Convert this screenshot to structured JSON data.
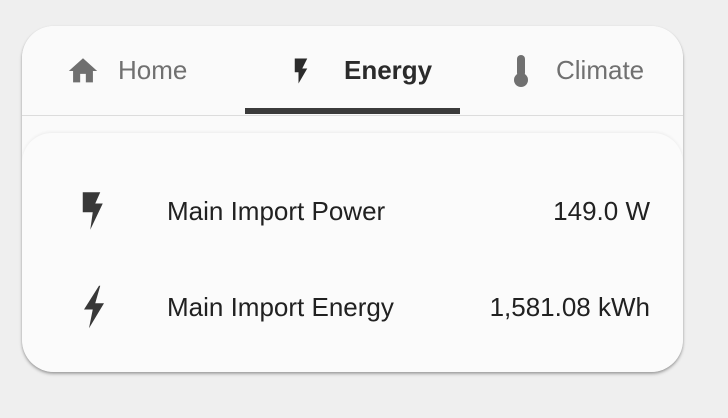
{
  "tabs": [
    {
      "label": "Home",
      "icon": "home-icon",
      "active": false
    },
    {
      "label": "Energy",
      "icon": "lightning-bolt-icon",
      "active": true
    },
    {
      "label": "Climate",
      "icon": "thermometer-icon",
      "active": false
    }
  ],
  "entities": [
    {
      "name": "Main Import Power",
      "value": "149.0 W",
      "icon": "flash-icon"
    },
    {
      "name": "Main Import Energy",
      "value": "1,581.08 kWh",
      "icon": "lightning-bolt-outline-icon"
    }
  ],
  "colors": {
    "background": "#efefef",
    "card": "#fafafa",
    "active_text": "#2b2b2b",
    "inactive_text": "#707070",
    "indicator": "#3b3b3b",
    "icon": "#383838"
  }
}
